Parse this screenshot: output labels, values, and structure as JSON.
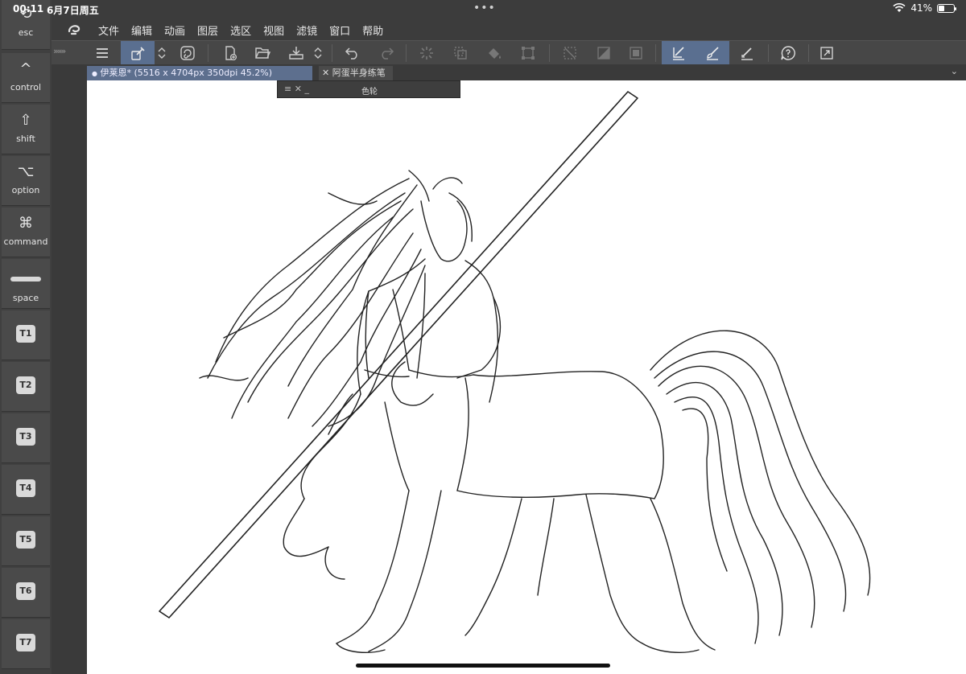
{
  "status": {
    "time": "00:11",
    "date": "6月7日周五",
    "battery_text": "41%",
    "battery_level": 0.41,
    "wifi_icon": "wifi-icon"
  },
  "side_keys": [
    {
      "label": "esc",
      "icon": "undo-arrow-icon"
    },
    {
      "label": "control",
      "icon": "caret-up-icon"
    },
    {
      "label": "shift",
      "icon": "shift-arrow-icon"
    },
    {
      "label": "option",
      "icon": "option-key-icon"
    },
    {
      "label": "command",
      "icon": "command-key-icon"
    },
    {
      "label": "space",
      "icon": "space-bar-icon"
    },
    {
      "label": "T1"
    },
    {
      "label": "T2"
    },
    {
      "label": "T3"
    },
    {
      "label": "T4"
    },
    {
      "label": "T5"
    },
    {
      "label": "T6"
    },
    {
      "label": "T7"
    }
  ],
  "menu": {
    "items": [
      "文件",
      "编辑",
      "动画",
      "图层",
      "选区",
      "视图",
      "滤镜",
      "窗口",
      "帮助"
    ]
  },
  "toolbar": {
    "expand_label": "»»»"
  },
  "tabs": {
    "active": "伊莱恩* (5516 x 4704px 350dpi 45.2%)",
    "second": "阿蛋半身练笔"
  },
  "panel": {
    "title": "色轮"
  },
  "colors": {
    "accent": "#5a6f90",
    "tab_active": "#5d6f8e",
    "background": "#3c3c3c"
  }
}
